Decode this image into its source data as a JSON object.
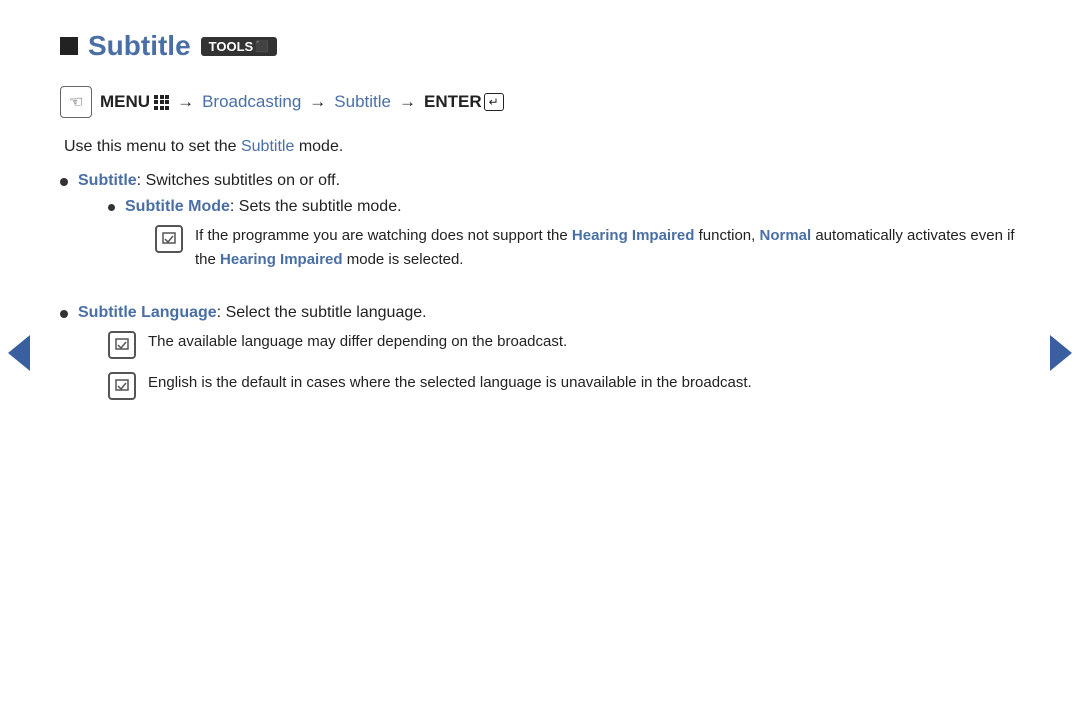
{
  "header": {
    "square_label": "",
    "title": "Subtitle",
    "tools_label": "TOOLS",
    "tools_icon": "⬛"
  },
  "menu_path": {
    "menu_icon": "☜",
    "menu_label": "MENU",
    "arrow1": "→",
    "broadcasting": "Broadcasting",
    "arrow2": "→",
    "subtitle": "Subtitle",
    "arrow3": "→",
    "enter_label": "ENTER",
    "enter_icon": "↵"
  },
  "description": "Use this menu to set the",
  "description_link": "Subtitle",
  "description_end": "mode.",
  "bullets": [
    {
      "link": "Subtitle",
      "text": ": Switches subtitles on or off.",
      "sub_bullets": [
        {
          "link": "Subtitle Mode",
          "text": ": Sets the subtitle mode.",
          "notes": [
            {
              "icon": "✎",
              "text_parts": [
                "If the programme you are watching does not support the ",
                "Hearing Impaired",
                " function, ",
                "Normal",
                " automatically activates even if the ",
                "Hearing Impaired",
                " mode is selected."
              ]
            }
          ]
        }
      ]
    },
    {
      "link": "Subtitle Language",
      "text": ": Select the subtitle language.",
      "sub_bullets": [],
      "notes": [
        {
          "icon": "✎",
          "text": "The available language may differ depending on the broadcast."
        },
        {
          "icon": "✎",
          "text": "English is the default in cases where the selected language is unavailable in the broadcast."
        }
      ]
    }
  ],
  "nav": {
    "left_arrow_label": "previous",
    "right_arrow_label": "next"
  },
  "colors": {
    "blue_link": "#4a6fa5",
    "text_dark": "#222222"
  }
}
